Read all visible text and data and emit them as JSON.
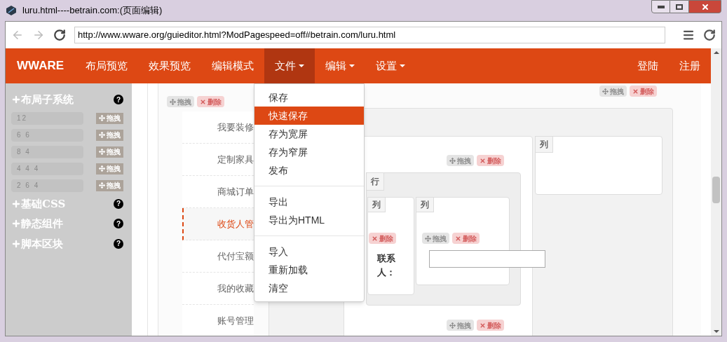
{
  "window": {
    "title": "luru.html----betrain.com:(页面编辑)"
  },
  "address_bar": {
    "url": "http://www.wware.org/guieditor.html?ModPagespeed=off#betrain.com/luru.html"
  },
  "navbar": {
    "brand": "WWARE",
    "items": [
      {
        "label": "布局预览",
        "dropdown": false,
        "selected": false
      },
      {
        "label": "效果预览",
        "dropdown": false,
        "selected": false
      },
      {
        "label": "编辑模式",
        "dropdown": false,
        "selected": false
      },
      {
        "label": "文件",
        "dropdown": true,
        "selected": true
      },
      {
        "label": "编辑",
        "dropdown": true,
        "selected": false
      },
      {
        "label": "设置",
        "dropdown": true,
        "selected": false
      }
    ],
    "right_items": [
      "登陆",
      "注册"
    ]
  },
  "file_menu": {
    "groups": [
      [
        {
          "label": "保存",
          "selected": false
        },
        {
          "label": "快速保存",
          "selected": true
        },
        {
          "label": "存为宽屏",
          "selected": false
        },
        {
          "label": "存为窄屏",
          "selected": false
        },
        {
          "label": "发布",
          "selected": false
        }
      ],
      [
        {
          "label": "导出",
          "selected": false
        },
        {
          "label": "导出为HTML",
          "selected": false
        }
      ],
      [
        {
          "label": "导入",
          "selected": false
        },
        {
          "label": "重新加载",
          "selected": false
        },
        {
          "label": "清空",
          "selected": false
        }
      ]
    ]
  },
  "sidebar": {
    "sections": [
      {
        "title": "布局子系统",
        "help": "?",
        "items": [
          {
            "value": "12",
            "button": "拖拽"
          },
          {
            "value": "6 6",
            "button": "拖拽"
          },
          {
            "value": "8 4",
            "button": "拖拽"
          },
          {
            "value": "4 4 4",
            "button": "拖拽"
          },
          {
            "value": "2 6 4",
            "button": "拖拽"
          }
        ]
      },
      {
        "title": "基础CSS",
        "help": "?"
      },
      {
        "title": "静态组件",
        "help": "?"
      },
      {
        "title": "脚本区块",
        "help": "?"
      }
    ]
  },
  "canvas": {
    "handles": [
      {
        "drag": "拖拽",
        "delete": "删除"
      },
      {
        "drag": "拖拽",
        "delete": "删除"
      },
      {
        "drag": "拖拽",
        "delete": "删除"
      },
      {
        "delete": "删除"
      },
      {
        "drag": "拖拽",
        "delete": "删除"
      },
      {
        "drag": "拖拽",
        "delete": "删除"
      }
    ],
    "nav_list": [
      {
        "label": "我要装修",
        "selected": false
      },
      {
        "label": "定制家具",
        "selected": false
      },
      {
        "label": "商城订单",
        "selected": false
      },
      {
        "label": "收货人管",
        "selected": true
      },
      {
        "label": "代付宝额",
        "selected": false
      },
      {
        "label": "我的收藏",
        "selected": false
      },
      {
        "label": "账号管理",
        "selected": false
      }
    ],
    "column_tags": [
      "列",
      "列",
      "列"
    ],
    "row_tag": "行",
    "field_label": "联系人："
  }
}
